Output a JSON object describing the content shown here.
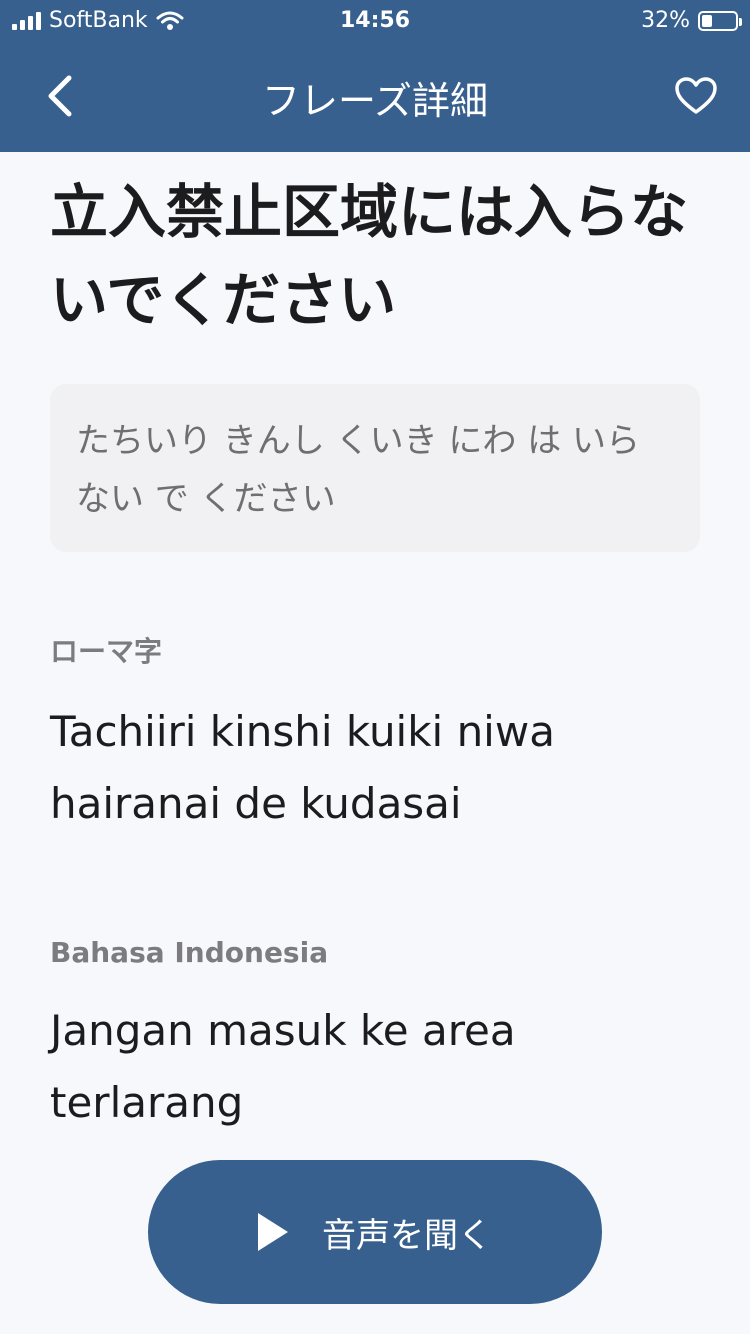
{
  "status_bar": {
    "carrier": "SoftBank",
    "time": "14:56",
    "battery": "32%"
  },
  "navbar": {
    "title": "フレーズ詳細",
    "back_icon": "chevron-left-icon",
    "favorite_icon": "heart-outline-icon"
  },
  "phrase": {
    "japanese": "立入禁止区域には入らないでください",
    "reading": "たちいり きんし くいき にわ は いらない で ください"
  },
  "romaji": {
    "label": "ローマ字",
    "text": "Tachiiri kinshi kuiki niwa hairanai de kudasai"
  },
  "translation": {
    "label": "Bahasa Indonesia",
    "text": "Jangan masuk ke area terlarang"
  },
  "play_button": {
    "label": "音声を聞く",
    "icon": "play-icon"
  },
  "colors": {
    "header": "#37608f",
    "background": "#f7f8fc"
  }
}
